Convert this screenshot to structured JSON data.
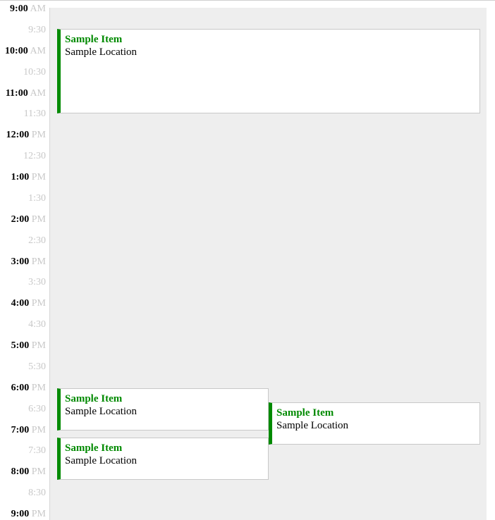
{
  "time_labels": [
    {
      "time": "9:00",
      "period": "AM",
      "half": false
    },
    {
      "time": "9:30",
      "period": "",
      "half": true
    },
    {
      "time": "10:00",
      "period": "AM",
      "half": false
    },
    {
      "time": "10:30",
      "period": "",
      "half": true
    },
    {
      "time": "11:00",
      "period": "AM",
      "half": false
    },
    {
      "time": "11:30",
      "period": "",
      "half": true
    },
    {
      "time": "12:00",
      "period": "PM",
      "half": false
    },
    {
      "time": "12:30",
      "period": "",
      "half": true
    },
    {
      "time": "1:00",
      "period": "PM",
      "half": false
    },
    {
      "time": "1:30",
      "period": "",
      "half": true
    },
    {
      "time": "2:00",
      "period": "PM",
      "half": false
    },
    {
      "time": "2:30",
      "period": "",
      "half": true
    },
    {
      "time": "3:00",
      "period": "PM",
      "half": false
    },
    {
      "time": "3:30",
      "period": "",
      "half": true
    },
    {
      "time": "4:00",
      "period": "PM",
      "half": false
    },
    {
      "time": "4:30",
      "period": "",
      "half": true
    },
    {
      "time": "5:00",
      "period": "PM",
      "half": false
    },
    {
      "time": "5:30",
      "period": "",
      "half": true
    },
    {
      "time": "6:00",
      "period": "PM",
      "half": false
    },
    {
      "time": "6:30",
      "period": "",
      "half": true
    },
    {
      "time": "7:00",
      "period": "PM",
      "half": false
    },
    {
      "time": "7:30",
      "period": "",
      "half": true
    },
    {
      "time": "8:00",
      "period": "PM",
      "half": false
    },
    {
      "time": "8:30",
      "period": "",
      "half": true
    },
    {
      "time": "9:00",
      "period": "PM",
      "half": false
    }
  ],
  "events": [
    {
      "title": "Sample Item",
      "location": "Sample Location"
    },
    {
      "title": "Sample Item",
      "location": "Sample Location"
    },
    {
      "title": "Sample Item",
      "location": "Sample Location"
    },
    {
      "title": "Sample Item",
      "location": "Sample Location"
    }
  ],
  "colors": {
    "event_accent": "#008a00",
    "grid_background": "#eeeeee",
    "muted_text": "#c8c8c8"
  }
}
